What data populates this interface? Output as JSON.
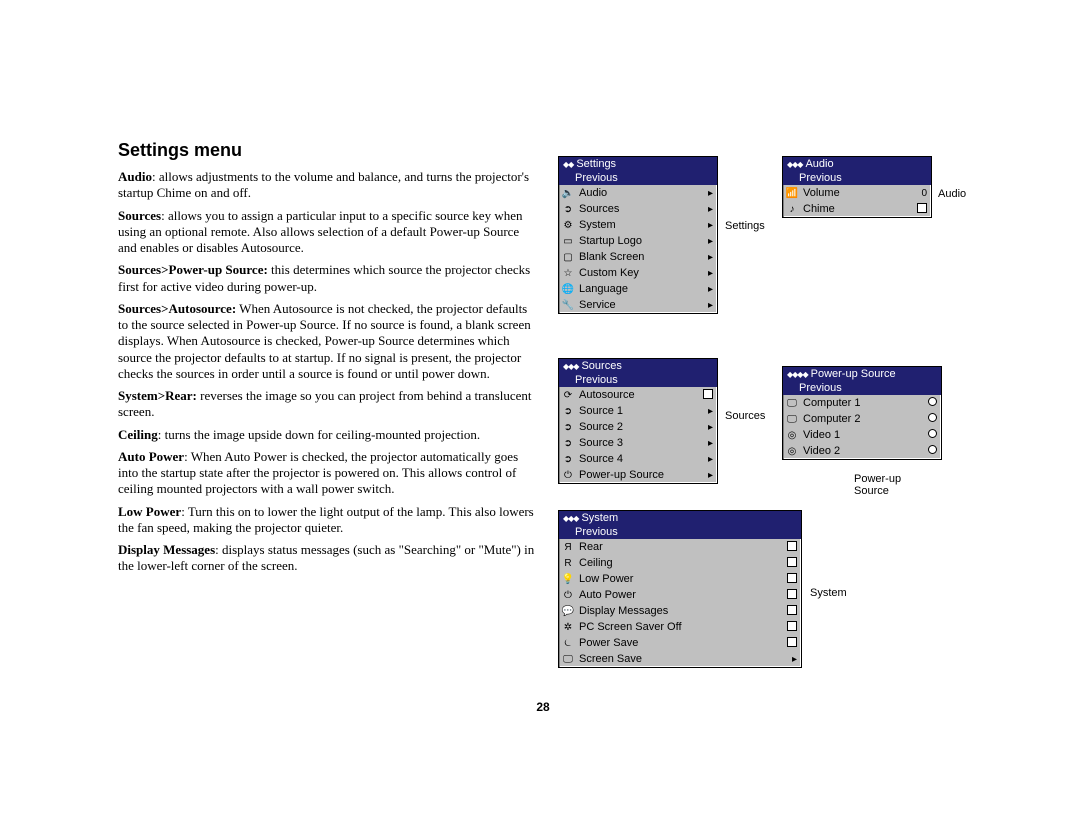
{
  "title": "Settings menu",
  "page_number": "28",
  "paragraphs": [
    {
      "bold": "Audio",
      "rest": ": allows adjustments to the volume and balance, and turns the projector's startup Chime on and off."
    },
    {
      "bold": "Sources",
      "rest": ": allows you to assign a particular input to a specific source key when using an optional remote. Also allows selection of a default Power-up Source and enables or disables Autosource."
    },
    {
      "bold": "Sources>Power-up Source:",
      "rest": " this determines which source the projector checks first for active video during power-up."
    },
    {
      "bold": "Sources>Autosource:",
      "rest": " When Autosource is not checked, the projector defaults to the source selected in Power-up Source. If no source is found, a blank screen displays. When Autosource is checked, Power-up Source determines which source the projector defaults to at startup. If no signal is present, the projector checks the sources in order until a source is found or until power down."
    },
    {
      "bold": "System>Rear:",
      "rest": " reverses the image so you can project from behind a translucent screen."
    },
    {
      "bold": "Ceiling",
      "rest": ": turns the image upside down for ceiling-mounted projection."
    },
    {
      "bold": "Auto Power",
      "rest": ": When Auto Power is checked, the projector automatically goes into the startup state after the projector is powered on. This allows control of ceiling mounted projectors with a wall power switch."
    },
    {
      "bold": "Low Power",
      "rest": ": Turn this on to lower the light output of the lamp. This also lowers the fan speed, making the projector quieter."
    },
    {
      "bold": "Display Messages",
      "rest": ": displays status messages (such as \"Searching\" or \"Mute\") in the lower-left corner of the screen."
    }
  ],
  "captions": {
    "settings": "Settings",
    "audio": "Audio",
    "sources": "Sources",
    "powerup": "Power-up Source",
    "system": "System"
  },
  "panels": {
    "settings": {
      "title": "Settings",
      "previous": "Previous",
      "items": [
        {
          "icon": "speaker-icon",
          "label": "Audio",
          "tail": "arrow"
        },
        {
          "icon": "source-icon",
          "label": "Sources",
          "tail": "arrow"
        },
        {
          "icon": "gear-icon",
          "label": "System",
          "tail": "arrow"
        },
        {
          "icon": "logo-icon",
          "label": "Startup Logo",
          "tail": "arrow"
        },
        {
          "icon": "blank-icon",
          "label": "Blank Screen",
          "tail": "arrow"
        },
        {
          "icon": "key-icon",
          "label": "Custom Key",
          "tail": "arrow"
        },
        {
          "icon": "globe-icon",
          "label": "Language",
          "tail": "arrow"
        },
        {
          "icon": "wrench-icon",
          "label": "Service",
          "tail": "arrow"
        }
      ]
    },
    "audio": {
      "title": "Audio",
      "previous": "Previous",
      "items": [
        {
          "icon": "volume-icon",
          "label": "Volume",
          "tail_text": "0"
        },
        {
          "icon": "chime-icon",
          "label": "Chime",
          "tail": "check"
        }
      ]
    },
    "sources": {
      "title": "Sources",
      "previous": "Previous",
      "items": [
        {
          "icon": "auto-icon",
          "label": "Autosource",
          "tail": "check"
        },
        {
          "icon": "source-icon",
          "label": "Source 1",
          "tail": "arrow"
        },
        {
          "icon": "source-icon",
          "label": "Source 2",
          "tail": "arrow"
        },
        {
          "icon": "source-icon",
          "label": "Source 3",
          "tail": "arrow"
        },
        {
          "icon": "source-icon",
          "label": "Source 4",
          "tail": "arrow"
        },
        {
          "icon": "power-icon",
          "label": "Power-up Source",
          "tail": "arrow"
        }
      ]
    },
    "powerup": {
      "title": "Power-up Source",
      "previous": "Previous",
      "items": [
        {
          "icon": "computer-icon",
          "label": "Computer 1",
          "tail": "radio"
        },
        {
          "icon": "computer-icon",
          "label": "Computer 2",
          "tail": "radio"
        },
        {
          "icon": "video-icon",
          "label": "Video 1",
          "tail": "radio"
        },
        {
          "icon": "video-icon",
          "label": "Video 2",
          "tail": "radio"
        }
      ]
    },
    "system": {
      "title": "System",
      "previous": "Previous",
      "items": [
        {
          "icon": "rear-icon",
          "label": "Rear",
          "tail": "check"
        },
        {
          "icon": "ceiling-icon",
          "label": "Ceiling",
          "tail": "check"
        },
        {
          "icon": "bulb-icon",
          "label": "Low Power",
          "tail": "check"
        },
        {
          "icon": "power-icon",
          "label": "Auto Power",
          "tail": "check"
        },
        {
          "icon": "msg-icon",
          "label": "Display Messages",
          "tail": "check"
        },
        {
          "icon": "saver-icon",
          "label": "PC Screen Saver Off",
          "tail": "check"
        },
        {
          "icon": "psave-icon",
          "label": "Power Save",
          "tail": "check"
        },
        {
          "icon": "screen-icon",
          "label": "Screen Save",
          "tail": "arrow"
        }
      ]
    }
  }
}
